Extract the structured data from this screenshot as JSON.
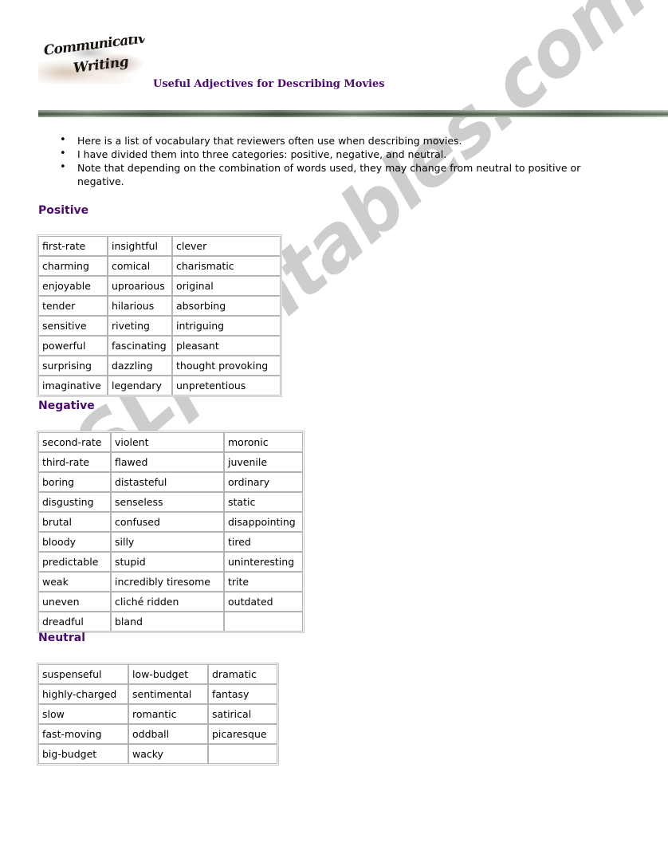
{
  "header": {
    "logo_line_1": "Communicative",
    "logo_line_2": "Writing",
    "title": "Useful Adjectives for Describing Movies",
    "title_color": "#4b0a6e"
  },
  "watermark": {
    "text": "ESLprintables.com",
    "color": "#cdcdcd"
  },
  "intro": {
    "bullets": [
      "Here is a list of vocabulary that reviewers often use when describing movies.",
      "I have divided them into three categories: positive, negative, and neutral.",
      "Note that depending on the combination of words used, they may change from neutral to positive or negative."
    ]
  },
  "sections": [
    {
      "id": "positive",
      "heading": "Positive",
      "heading_color": "#4b0a6e",
      "rows": [
        [
          "first-rate",
          "insightful",
          "clever"
        ],
        [
          "charming",
          "comical",
          "charismatic"
        ],
        [
          "enjoyable",
          "uproarious",
          "original"
        ],
        [
          "tender",
          "hilarious",
          "absorbing"
        ],
        [
          "sensitive",
          "riveting",
          "intriguing"
        ],
        [
          "powerful",
          "fascinating",
          "pleasant"
        ],
        [
          "surprising",
          "dazzling",
          "thought provoking"
        ],
        [
          "imaginative",
          "legendary",
          "unpretentious"
        ]
      ]
    },
    {
      "id": "negative",
      "heading": "Negative",
      "heading_color": "#4b0a6e",
      "rows": [
        [
          "second-rate",
          "violent",
          "moronic"
        ],
        [
          "third-rate",
          "flawed",
          "juvenile"
        ],
        [
          "boring",
          "distasteful",
          "ordinary"
        ],
        [
          "disgusting",
          "senseless",
          "static"
        ],
        [
          "brutal",
          "confused",
          "disappointing"
        ],
        [
          "bloody",
          "silly",
          "tired"
        ],
        [
          "predictable",
          "stupid",
          "uninteresting"
        ],
        [
          "weak",
          "incredibly tiresome",
          "trite"
        ],
        [
          "uneven",
          "cliché ridden",
          "outdated"
        ],
        [
          "dreadful",
          "bland",
          ""
        ]
      ]
    },
    {
      "id": "neutral",
      "heading": "Neutral",
      "heading_color": "#4b0a6e",
      "rows": [
        [
          "suspenseful",
          "low-budget",
          "dramatic"
        ],
        [
          "highly-charged",
          "sentimental",
          "fantasy"
        ],
        [
          "slow",
          "romantic",
          "satirical"
        ],
        [
          "fast-moving",
          "oddball",
          "picaresque"
        ],
        [
          "big-budget",
          "wacky",
          ""
        ]
      ]
    }
  ]
}
